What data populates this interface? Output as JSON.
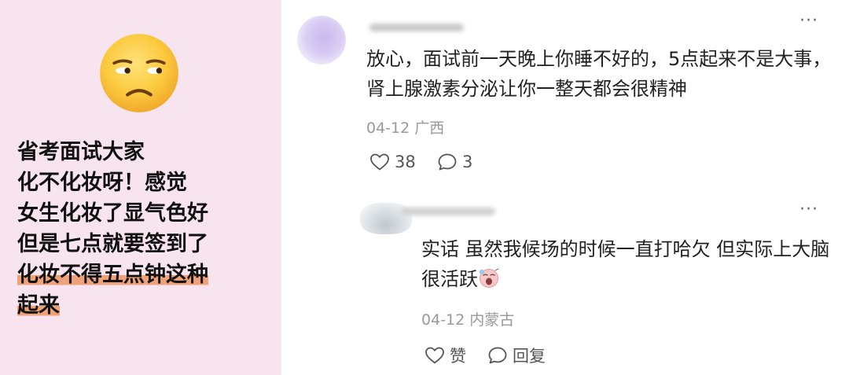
{
  "post": {
    "emoji": "unamused-face",
    "lines": [
      "省考面试大家",
      "化不化妆呀！感觉",
      "女生化妆了显气色好",
      "但是七点就要签到了",
      "化妆不得五点钟这种",
      "起来"
    ],
    "highlight_color": "#f0a178",
    "background_color": "#f7e4ef"
  },
  "comments": [
    {
      "text": "放心，面试前一天晚上你睡不好的，5点起来不是大事，肾上腺激素分泌让你一整天都会很精神",
      "date": "04-12",
      "location": "广西",
      "likes": "38",
      "replies": "3"
    },
    {
      "text": "实话 虽然我候场的时候一直打哈欠 但实际上大脑很活跃",
      "date": "04-12",
      "location": "内蒙古",
      "like_label": "赞",
      "reply_label": "回复"
    }
  ]
}
